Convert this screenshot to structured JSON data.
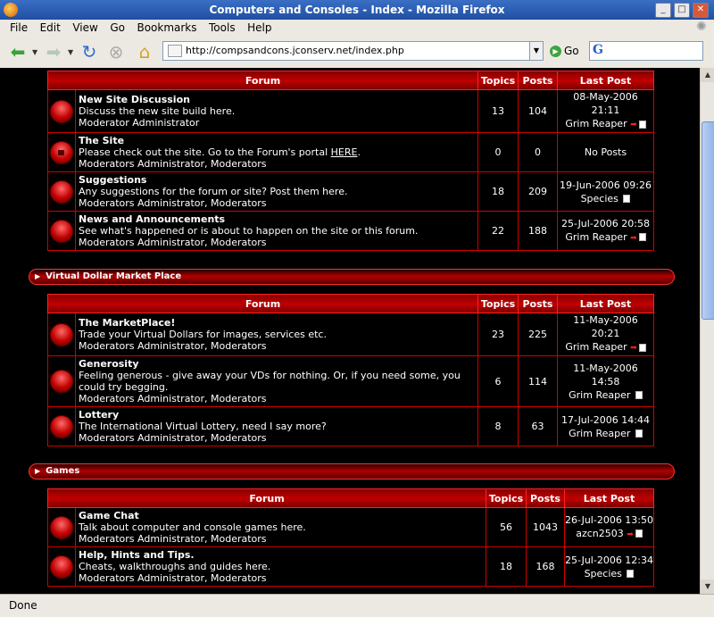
{
  "window": {
    "title": "Computers and Consoles - Index - Mozilla Firefox"
  },
  "menu": [
    "File",
    "Edit",
    "View",
    "Go",
    "Bookmarks",
    "Tools",
    "Help"
  ],
  "toolbar": {
    "url": "http://compsandcons.jconserv.net/index.php",
    "go_label": "Go",
    "search_value": ""
  },
  "table_headers": {
    "forum": "Forum",
    "topics": "Topics",
    "posts": "Posts",
    "last_post": "Last Post"
  },
  "categories": [
    {
      "title": "",
      "forums": [
        {
          "name": "New Site Discussion",
          "desc": "Discuss the new site build here.",
          "mods": "Moderator Administrator",
          "topics": "13",
          "posts": "104",
          "last_date": "08-May-2006 21:11",
          "last_user": "Grim Reaper",
          "locked": false
        },
        {
          "name": "The Site",
          "desc_pre": "Please check out the site. Go to the Forum's portal ",
          "desc_link": "HERE",
          "desc_post": ".",
          "mods": "Moderators Administrator, Moderators",
          "topics": "0",
          "posts": "0",
          "last_date": "No Posts",
          "last_user": "",
          "locked": true
        },
        {
          "name": "Suggestions",
          "desc": "Any suggestions for the forum or site? Post them here.",
          "mods": "Moderators Administrator, Moderators",
          "topics": "18",
          "posts": "209",
          "last_date": "19-Jun-2006 09:26",
          "last_user": "Species",
          "locked": false
        },
        {
          "name": "News and Announcements",
          "desc": "See what's happened or is about to happen on the site or this forum.",
          "mods": "Moderators Administrator, Moderators",
          "topics": "22",
          "posts": "188",
          "last_date": "25-Jul-2006 20:58",
          "last_user": "Grim Reaper",
          "locked": false
        }
      ]
    },
    {
      "title": "Virtual Dollar Market Place",
      "forums": [
        {
          "name": "The MarketPlace!",
          "desc": "Trade your Virtual Dollars for images, services etc.",
          "mods": "Moderators Administrator, Moderators",
          "topics": "23",
          "posts": "225",
          "last_date": "11-May-2006 20:21",
          "last_user": "Grim Reaper"
        },
        {
          "name": "Generosity",
          "desc": "Feeling generous - give away your VDs for nothing. Or, if you need some, you could try begging.",
          "mods": "Moderators Administrator, Moderators",
          "topics": "6",
          "posts": "114",
          "last_date": "11-May-2006 14:58",
          "last_user": "Grim Reaper"
        },
        {
          "name": "Lottery",
          "desc": "The International Virtual Lottery, need I say more?",
          "mods": "Moderators Administrator, Moderators",
          "topics": "8",
          "posts": "63",
          "last_date": "17-Jul-2006 14:44",
          "last_user": "Grim Reaper"
        }
      ]
    },
    {
      "title": "Games",
      "forums": [
        {
          "name": "Game Chat",
          "desc": "Talk about computer and console games here.",
          "mods": "Moderators Administrator, Moderators",
          "topics": "56",
          "posts": "1043",
          "last_date": "26-Jul-2006 13:50",
          "last_user": "azcn2503"
        },
        {
          "name": "Help, Hints and Tips.",
          "desc": "Cheats, walkthroughs and guides here.",
          "mods": "Moderators Administrator, Moderators",
          "topics": "18",
          "posts": "168",
          "last_date": "25-Jul-2006 12:34",
          "last_user": "Species"
        }
      ]
    }
  ],
  "status": "Done"
}
